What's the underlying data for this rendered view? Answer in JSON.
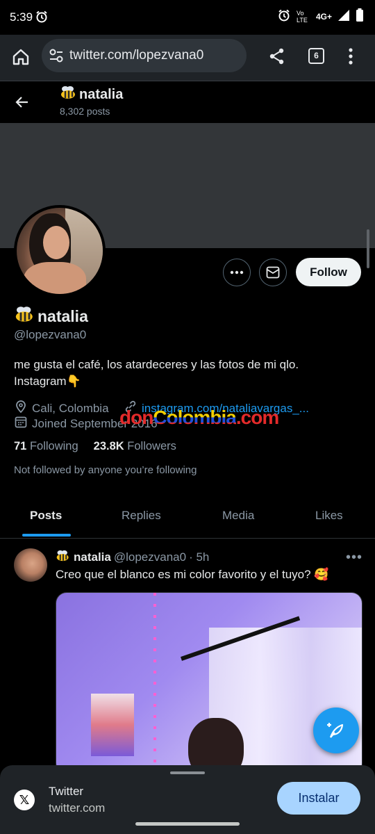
{
  "status_bar": {
    "time": "5:39",
    "network": "4G+",
    "volte": "Vo LTE"
  },
  "browser": {
    "url": "twitter.com/lopezvana0",
    "tab_count": "6"
  },
  "header": {
    "name": "natalia",
    "posts_count": "8,302 posts"
  },
  "profile": {
    "name": "natalia",
    "handle": "@lopezvana0",
    "bio": "me gusta el café, los atardeceres y las fotos de mi qlo. Instagram👇",
    "location": "Cali, Colombia",
    "link": "instagram.com/nataliavargas_...",
    "joined": "Joined September 2016",
    "following_count": "71",
    "following_label": "Following",
    "followers_count": "23.8K",
    "followers_label": "Followers",
    "not_followed": "Not followed by anyone you’re following",
    "follow_label": "Follow"
  },
  "watermark": {
    "part1": "don",
    "part2": "Colombia",
    "part3": ".com"
  },
  "tabs": [
    {
      "label": "Posts"
    },
    {
      "label": "Replies"
    },
    {
      "label": "Media"
    },
    {
      "label": "Likes"
    }
  ],
  "post": {
    "name": "natalia",
    "handle": "@lopezvana0",
    "time": "· 5h",
    "text": "Creo que el blanco es mi color favorito y el tuyo? 🥰"
  },
  "app_banner": {
    "title": "Twitter",
    "url": "twitter.com",
    "install_label": "Instalar"
  },
  "colors": {
    "accent": "#1d9bf0",
    "background": "#000000",
    "banner": "#333639"
  }
}
